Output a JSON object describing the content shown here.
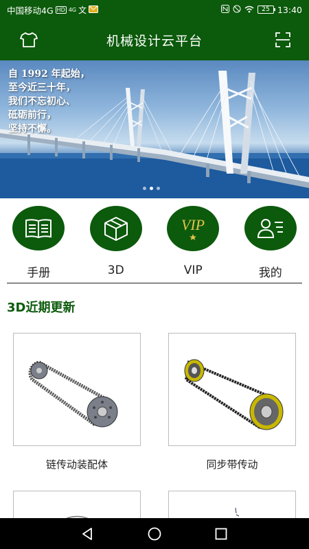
{
  "status_bar": {
    "carrier": "中国移动4G",
    "hd_badge": "HD",
    "network_badge": "4G",
    "signal_sub": "ill",
    "battery": "25",
    "time": "13:40"
  },
  "app_bar": {
    "title": "机械设计云平台",
    "left_icon": "tshirt-icon",
    "right_icon": "scan-icon"
  },
  "banner": {
    "lines": [
      "自 1992 年起始，",
      "至今近三十年，",
      "我们不忘初心、",
      "砥砺前行，",
      "坚持不懈。"
    ],
    "slide_count": 3,
    "active_slide": 2
  },
  "quick_menu": [
    {
      "label": "手册",
      "icon": "book-icon"
    },
    {
      "label": "3D",
      "icon": "cube-icon"
    },
    {
      "label": "VIP",
      "icon": "vip-icon"
    },
    {
      "label": "我的",
      "icon": "user-card-icon"
    }
  ],
  "section": {
    "title": "3D近期更新"
  },
  "items": [
    {
      "caption": "链传动装配体",
      "image": "chain-drive-assembly"
    },
    {
      "caption": "同步带传动",
      "image": "timing-belt-drive"
    },
    {
      "caption": "",
      "image": "partial-model"
    },
    {
      "caption": "",
      "image": "partial-model"
    }
  ],
  "colors": {
    "primary": "#0c5a0c",
    "vip_gold": "#e3c34a",
    "nav_bar": "#000000"
  },
  "nav_bar": [
    "back-icon",
    "home-icon",
    "recents-icon"
  ]
}
